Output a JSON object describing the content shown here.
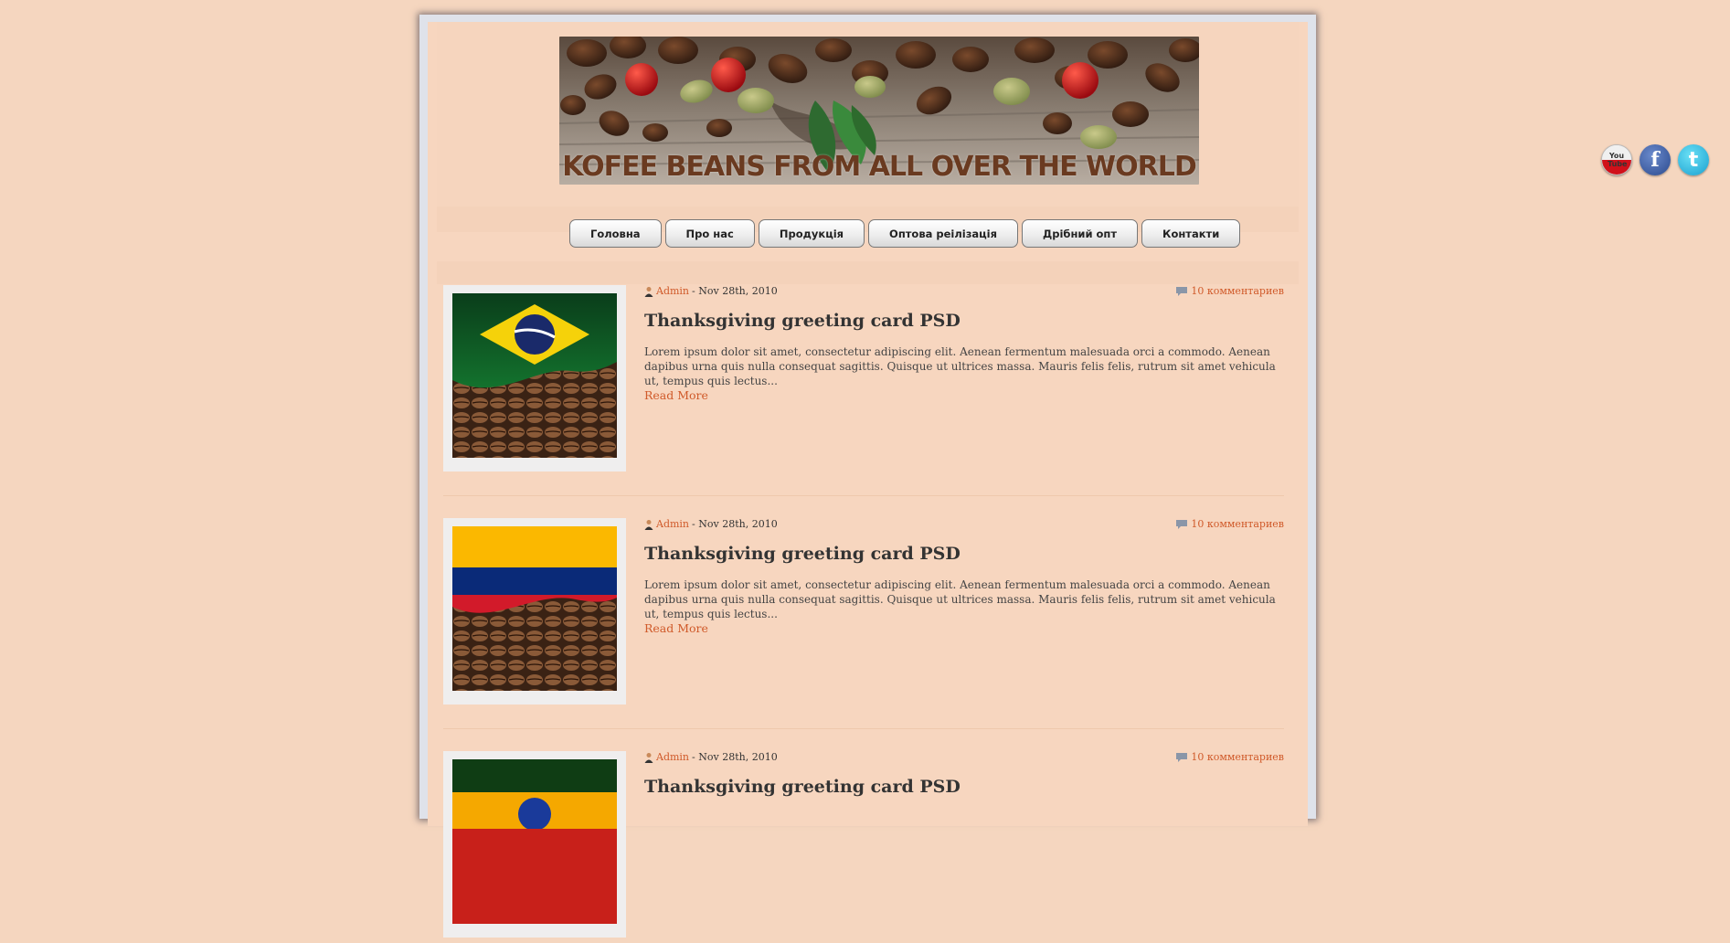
{
  "header": {
    "banner_title": "KOFEE BEANS FROM ALL OVER THE WORLD"
  },
  "nav": {
    "items": [
      {
        "label": "Головна"
      },
      {
        "label": "Про нас"
      },
      {
        "label": "Продукція"
      },
      {
        "label": "Оптова реілізація"
      },
      {
        "label": "Дрібний опт"
      },
      {
        "label": "Контакти"
      }
    ]
  },
  "posts": [
    {
      "author": "Admin",
      "date": "- Nov 28th, 2010",
      "comments": "10 комментариев",
      "title": "Thanksgiving greeting card PSD",
      "excerpt": "Lorem ipsum dolor sit amet, consectetur adipiscing elit. Aenean fermentum malesuada orci a commodo. Aenean dapibus urna quis nulla consequat sagittis. Quisque ut ultrices massa. Mauris felis felis, rutrum sit amet vehicula ut, tempus quis lectus...",
      "read_more": "Read More",
      "flag": "brazil-flag"
    },
    {
      "author": "Admin",
      "date": "- Nov 28th, 2010",
      "comments": "10 комментариев",
      "title": "Thanksgiving greeting card PSD",
      "excerpt": "Lorem ipsum dolor sit amet, consectetur adipiscing elit. Aenean fermentum malesuada orci a commodo. Aenean dapibus urna quis nulla consequat sagittis. Quisque ut ultrices massa. Mauris felis felis, rutrum sit amet vehicula ut, tempus quis lectus...",
      "read_more": "Read More",
      "flag": "colombia-flag"
    },
    {
      "author": "Admin",
      "date": "- Nov 28th, 2010",
      "comments": "10 комментариев",
      "title": "Thanksgiving greeting card PSD",
      "flag": "ethiopia-flag"
    }
  ],
  "social": {
    "youtube": "You Tube",
    "facebook": "f",
    "twitter": "t"
  },
  "colors": {
    "background": "#f5d6bf",
    "link": "#d05a2a",
    "title": "#333333"
  }
}
